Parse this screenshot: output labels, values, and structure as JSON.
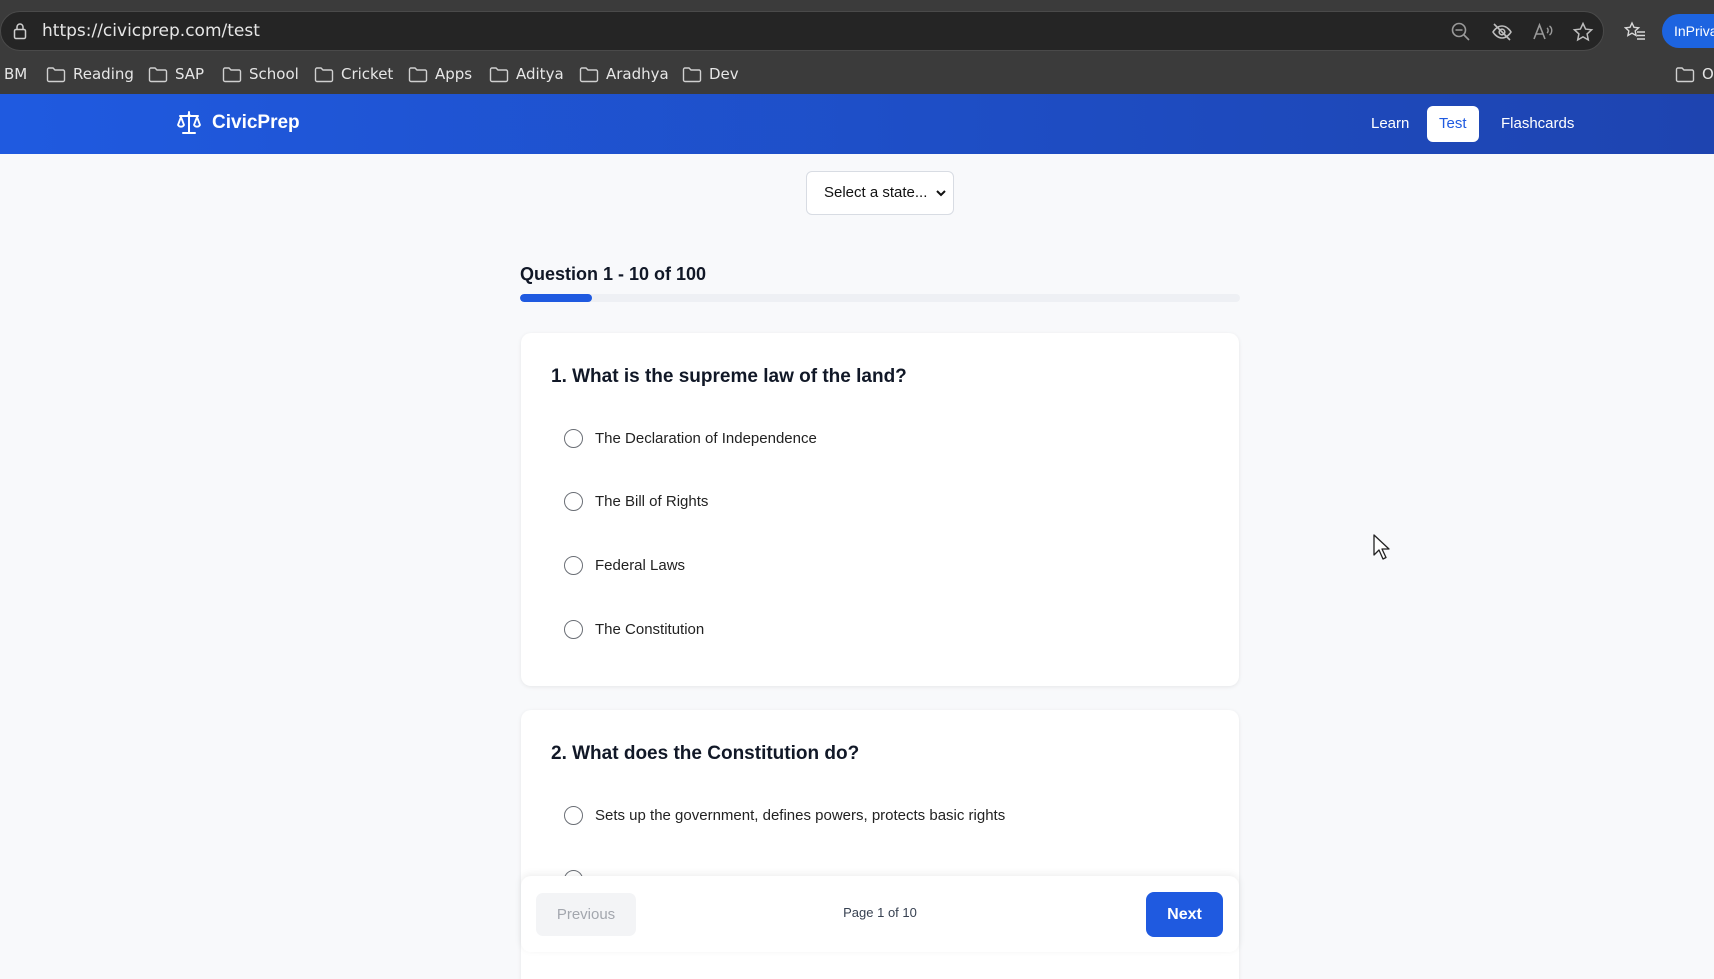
{
  "browser": {
    "url": "https://civicprep.com/test",
    "inprivate_label": "InPrivate",
    "bookmarks": [
      "BM",
      "Reading",
      "SAP",
      "School",
      "Cricket",
      "Apps",
      "Aditya",
      "Aradhya",
      "Dev",
      "O"
    ]
  },
  "header": {
    "brand": "CivicPrep",
    "nav": [
      "Learn",
      "Test",
      "Flashcards"
    ],
    "active_nav": "Test"
  },
  "state_select": {
    "value": "Select a state..."
  },
  "progress": {
    "label": "Question 1 - 10 of 100",
    "fraction": 0.1
  },
  "questions": [
    {
      "title": "1. What is the supreme law of the land?",
      "options": [
        "The Declaration of Independence",
        "The Bill of Rights",
        "Federal Laws",
        "The Constitution"
      ]
    },
    {
      "title": "2. What does the Constitution do?",
      "options": [
        "Sets up the government, defines powers, protects basic rights"
      ]
    }
  ],
  "pagination": {
    "previous": "Previous",
    "page_info": "Page 1 of 10",
    "next": "Next"
  },
  "colors": {
    "brand": "#1f5ae0",
    "chrome": "#3b3b3b"
  }
}
